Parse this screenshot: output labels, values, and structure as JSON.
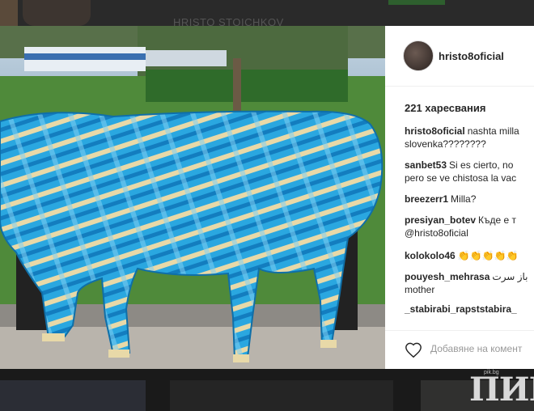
{
  "background": {
    "ghost_text": "HRISTO STOICHKOV"
  },
  "post": {
    "username": "hristo8oficial",
    "likes": "221 харесвания",
    "comments": [
      {
        "user": "hristo8oficial",
        "text": "nashta milla",
        "cont": "slovenka????????"
      },
      {
        "user": "sanbet53",
        "text": "Si es cierto, no",
        "cont": "pero se ve chistosa la vac"
      },
      {
        "user": "breezerr1",
        "text": "Milla?"
      },
      {
        "user": "presiyan_botev",
        "text": "Къде е т",
        "mention": "@hristo8oficial"
      },
      {
        "user": "kolokolo46",
        "text": "👏👏👏👏👏"
      },
      {
        "user": "pouyesh_mehrasa",
        "text": "ﺑﺎﺯ ﺳﺮﺕ",
        "cont": "mother"
      },
      {
        "user": "_stabirabi_rapststabira_",
        "text": ""
      }
    ],
    "add_comment_placeholder": "Добавяне на комент"
  },
  "watermark": {
    "site": "pik.bg",
    "logo": "ПИК"
  },
  "colors": {
    "cow_blue": "#2aa7e0",
    "cow_stripe": "#e8d9a8",
    "username": "#262626",
    "mention": "#003569"
  }
}
